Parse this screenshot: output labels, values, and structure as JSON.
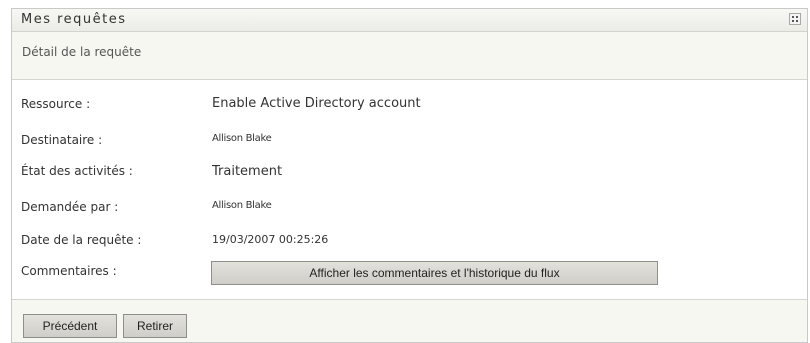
{
  "window": {
    "title": "Mes requêtes",
    "menu_icon": "grid-menu-icon"
  },
  "subheader": {
    "title": "Détail de la requête"
  },
  "details": {
    "resource": {
      "label": "Ressource :",
      "value": "Enable Active Directory account"
    },
    "recipient": {
      "label": "Destinataire :",
      "value": "Allison Blake"
    },
    "activity_state": {
      "label": "État des activités :",
      "value": "Traitement"
    },
    "requested_by": {
      "label": "Demandée par :",
      "value": "Allison Blake"
    },
    "request_date": {
      "label": "Date de la requête :",
      "value": "19/03/2007 00:25:26"
    },
    "comments": {
      "label": "Commentaires :",
      "button_label": "Afficher les commentaires et l'historique du flux"
    }
  },
  "footer": {
    "previous_label": "Précédent",
    "withdraw_label": "Retirer"
  }
}
